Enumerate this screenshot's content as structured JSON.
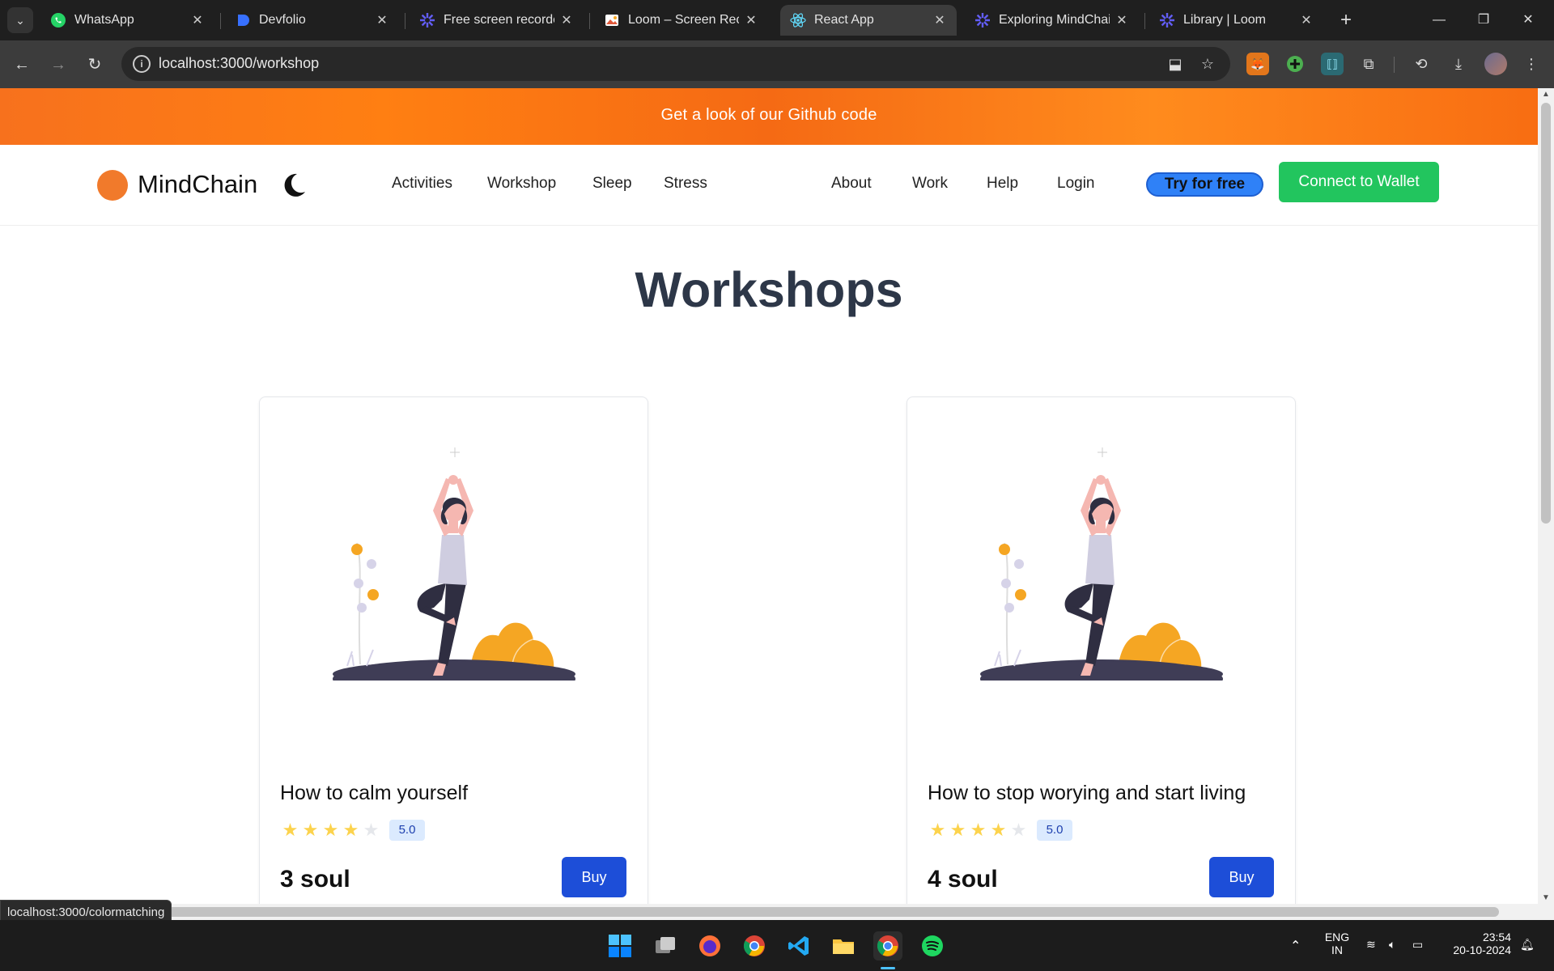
{
  "browser": {
    "tabs": [
      {
        "title": "WhatsApp",
        "icon": "whatsapp-icon"
      },
      {
        "title": "Devfolio",
        "icon": "devfolio-icon"
      },
      {
        "title": "Free screen recorder",
        "icon": "loom-icon"
      },
      {
        "title": "Loom – Screen Recor",
        "icon": "loom-app-icon"
      },
      {
        "title": "React App",
        "icon": "react-icon",
        "active": true
      },
      {
        "title": "Exploring MindChain",
        "icon": "loom-icon"
      },
      {
        "title": "Library | Loom",
        "icon": "loom-icon"
      }
    ],
    "url": "localhost:3000/workshop",
    "status_url": "localhost:3000/colormatching"
  },
  "banner": {
    "text": "Get a look of our Github code"
  },
  "nav": {
    "brand": "MindChain",
    "links_left": [
      "Activities",
      "Workshop",
      "Sleep",
      "Stress"
    ],
    "links_right": [
      "About",
      "Work",
      "Help",
      "Login"
    ],
    "try_label": "Try for free",
    "wallet_label": "Connect to Wallet"
  },
  "page": {
    "title": "Workshops"
  },
  "cards": [
    {
      "title": "How to calm yourself",
      "stars_filled": 4,
      "stars_total": 5,
      "rating": "5.0",
      "price": "3 soul",
      "buy_label": "Buy"
    },
    {
      "title": "How to stop worying and start living",
      "stars_filled": 4,
      "stars_total": 5,
      "rating": "5.0",
      "price": "4 soul",
      "buy_label": "Buy"
    }
  ],
  "taskbar": {
    "lang": "ENG",
    "region": "IN",
    "time": "23:54",
    "date": "20-10-2024"
  },
  "colors": {
    "accent_orange": "#f7711d",
    "wallet_green": "#22c55e",
    "buy_blue": "#1d4ed8",
    "try_blue": "#2f81f7",
    "star_yellow": "#fcd34d"
  }
}
